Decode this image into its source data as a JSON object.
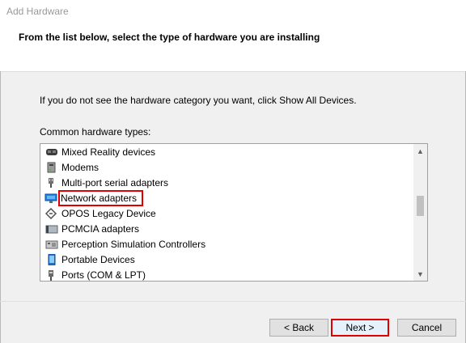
{
  "window": {
    "title": "Add Hardware"
  },
  "header": {
    "text": "From the list below, select the type of hardware you are installing"
  },
  "instruction": "If you do not see the hardware category you want, click Show All Devices.",
  "list_label": "Common hardware types:",
  "items": [
    {
      "label": "Mixed Reality devices",
      "icon": "mixed-reality-icon"
    },
    {
      "label": "Modems",
      "icon": "modem-icon"
    },
    {
      "label": "Multi-port serial adapters",
      "icon": "serial-adapter-icon"
    },
    {
      "label": "Network adapters",
      "icon": "network-adapter-icon",
      "highlighted": true
    },
    {
      "label": "OPOS Legacy Device",
      "icon": "opos-device-icon"
    },
    {
      "label": "PCMCIA adapters",
      "icon": "pcmcia-icon"
    },
    {
      "label": "Perception Simulation Controllers",
      "icon": "perception-controller-icon"
    },
    {
      "label": "Portable Devices",
      "icon": "portable-device-icon"
    },
    {
      "label": "Ports (COM & LPT)",
      "icon": "ports-icon"
    }
  ],
  "buttons": {
    "back": "< Back",
    "next": "Next >",
    "cancel": "Cancel"
  },
  "colors": {
    "highlight": "#e00000",
    "accent": "#0078d7"
  }
}
